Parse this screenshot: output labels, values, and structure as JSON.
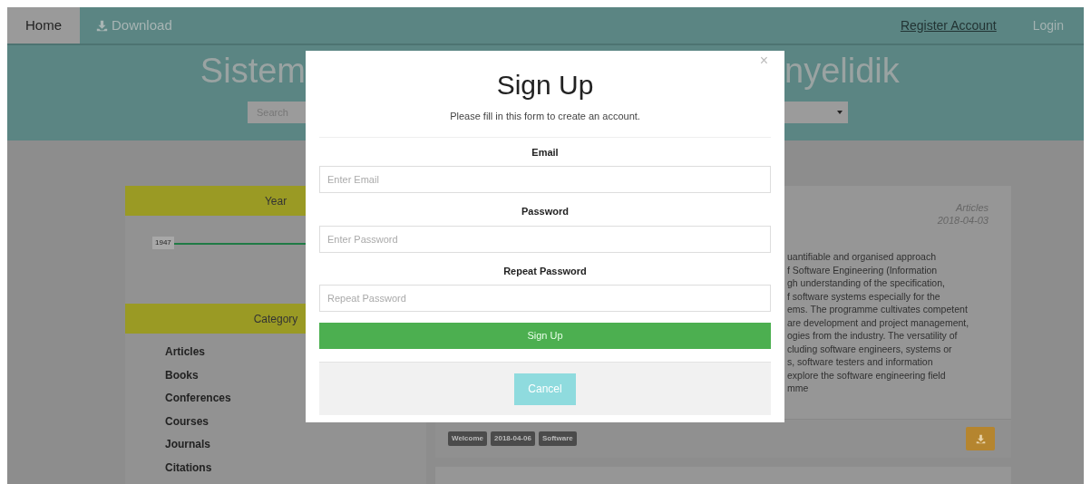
{
  "nav": {
    "items": [
      {
        "label": "Home",
        "selected": true
      },
      {
        "label": "Download",
        "selected": false
      }
    ],
    "right": [
      {
        "label": "Register Account",
        "kind": "link"
      },
      {
        "label": "Login",
        "kind": "muted"
      }
    ]
  },
  "header": {
    "title_parts": [
      "Sistem",
      "nyelidik"
    ],
    "search": {
      "placeholder": "Search"
    }
  },
  "sidebar": {
    "year": {
      "heading": "Year",
      "slider_label": "1947"
    },
    "category": {
      "heading": "Category",
      "items": [
        "Articles",
        "Books",
        "Conferences",
        "Courses",
        "Journals",
        "Citations"
      ]
    }
  },
  "post": {
    "category": "Articles",
    "date": "2018-04-03",
    "lines": [
      "uantifiable and organised approach",
      "f Software Engineering (Information",
      "gh understanding of the specification,",
      "f software systems especially for the",
      "ems. The programme cultivates competent",
      "are development and project management,",
      "ogies from the industry. The versatility of",
      "cluding software engineers, systems or",
      "s, software testers and information",
      "explore the software engineering field",
      "mme"
    ],
    "tags": [
      "Welcome",
      "2018-04-06",
      "Software"
    ]
  },
  "modal": {
    "title": "Sign Up",
    "subtitle": "Please fill in this form to create an account.",
    "close": "×",
    "fields": [
      {
        "label": "Email",
        "placeholder": "Enter Email"
      },
      {
        "label": "Password",
        "placeholder": "Enter Password"
      },
      {
        "label": "Repeat Password",
        "placeholder": "Repeat Password"
      }
    ],
    "submit": "Sign Up",
    "cancel": "Cancel"
  }
}
